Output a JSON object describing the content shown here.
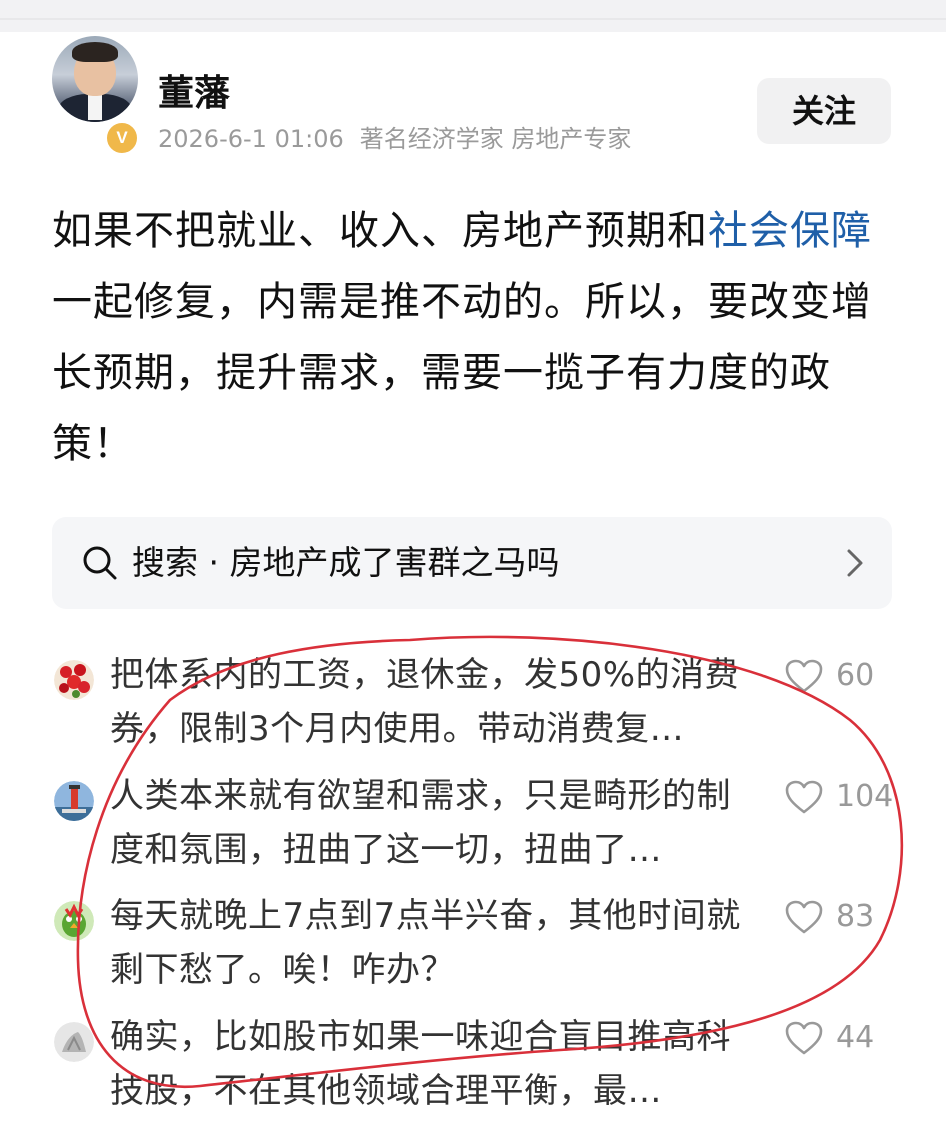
{
  "post": {
    "author_name": "董藩",
    "timestamp": "2026-6-1 01:06",
    "author_tags": "著名经济学家 房地产专家",
    "verified_badge": "V",
    "follow_label": "关注",
    "body_before_link": "如果不把就业、收入、房地产预期和",
    "body_link": "社会保障",
    "body_after_link": "一起修复，内需是推不动的。所以，要改变增长预期，提升需求，需要一揽子有力度的政策！"
  },
  "search": {
    "label": "搜索 · 房地产成了害群之马吗",
    "icon": "search-icon"
  },
  "comments": [
    {
      "text": "把体系内的工资，退休金，发50%的消费券，限制3个月内使用。带动消费复…",
      "likes": "60",
      "avatar": "red-flowers"
    },
    {
      "text": "人类本来就有欲望和需求，只是畸形的制度和氛围，扭曲了这一切，扭曲了…",
      "likes": "104",
      "avatar": "lighthouse"
    },
    {
      "text": "每天就晚上7点到7点半兴奋，其他时间就剩下愁了。唉！咋办？",
      "likes": "83",
      "avatar": "green-bird"
    },
    {
      "text": "确实，比如股市如果一味迎合盲目推高科技股，不在其他领域合理平衡，最…",
      "likes": "44",
      "avatar": "grey-sketch"
    }
  ],
  "colors": {
    "link": "#1f5fa8",
    "annotation": "#d9303a",
    "badge": "#f0b84a"
  }
}
